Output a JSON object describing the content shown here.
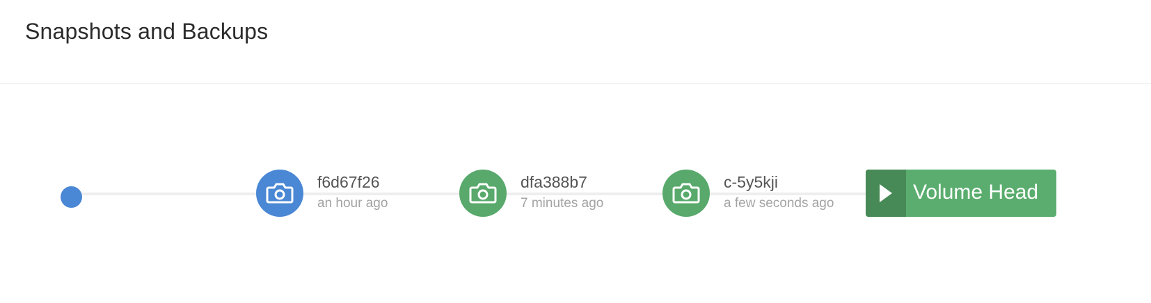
{
  "panel": {
    "title": "Snapshots and Backups"
  },
  "timeline": {
    "snapshots": [
      {
        "id": "f6d67f26",
        "time": "an hour ago",
        "color": "#4a87d4",
        "icon": "camera-icon"
      },
      {
        "id": "dfa388b7",
        "time": "7 minutes ago",
        "color": "#58a96b",
        "icon": "camera-icon"
      },
      {
        "id": "c-5y5kji",
        "time": "a few seconds ago",
        "color": "#58a96b",
        "icon": "camera-icon"
      }
    ],
    "volume_head": {
      "label": "Volume Head",
      "icon": "play-icon",
      "color": "#5aad6e"
    },
    "start_dot_color": "#4a87d4"
  }
}
